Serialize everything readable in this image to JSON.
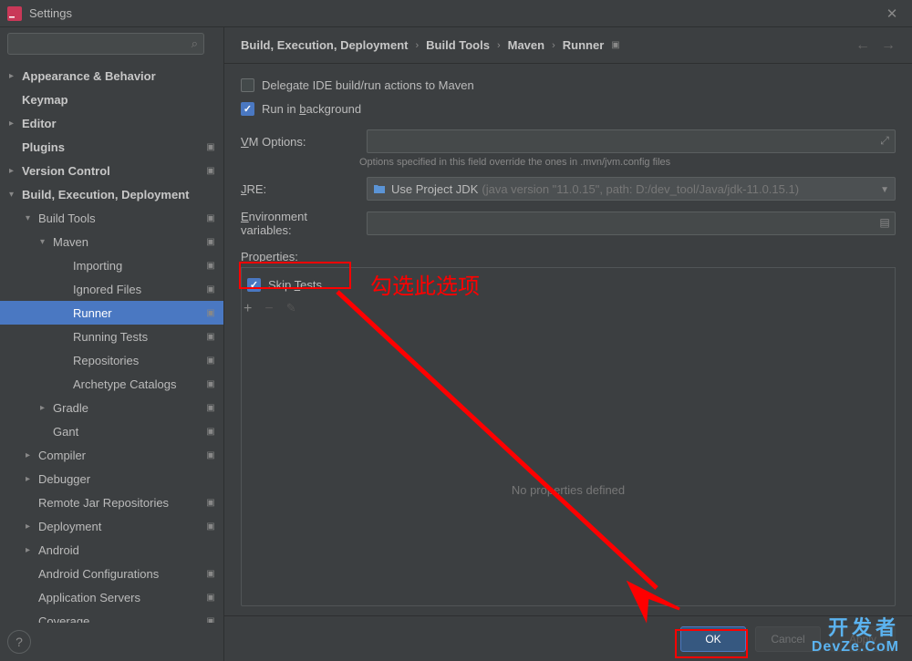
{
  "window": {
    "title": "Settings"
  },
  "search": {
    "placeholder": ""
  },
  "sidebar": {
    "items": [
      {
        "label": "Appearance & Behavior",
        "bold": true,
        "expandable": true,
        "expanded": false,
        "indent": 0,
        "mod": false
      },
      {
        "label": "Keymap",
        "bold": true,
        "expandable": false,
        "indent": 0,
        "mod": false
      },
      {
        "label": "Editor",
        "bold": true,
        "expandable": true,
        "expanded": false,
        "indent": 0,
        "mod": false
      },
      {
        "label": "Plugins",
        "bold": true,
        "expandable": false,
        "indent": 0,
        "mod": true
      },
      {
        "label": "Version Control",
        "bold": true,
        "expandable": true,
        "expanded": false,
        "indent": 0,
        "mod": true
      },
      {
        "label": "Build, Execution, Deployment",
        "bold": true,
        "expandable": true,
        "expanded": true,
        "indent": 0,
        "mod": false
      },
      {
        "label": "Build Tools",
        "bold": false,
        "expandable": true,
        "expanded": true,
        "indent": 1,
        "mod": true
      },
      {
        "label": "Maven",
        "bold": false,
        "expandable": true,
        "expanded": true,
        "indent": 2,
        "mod": true
      },
      {
        "label": "Importing",
        "bold": false,
        "expandable": false,
        "indent": 3,
        "mod": true
      },
      {
        "label": "Ignored Files",
        "bold": false,
        "expandable": false,
        "indent": 3,
        "mod": true
      },
      {
        "label": "Runner",
        "bold": false,
        "expandable": false,
        "indent": 3,
        "mod": true,
        "selected": true
      },
      {
        "label": "Running Tests",
        "bold": false,
        "expandable": false,
        "indent": 3,
        "mod": true
      },
      {
        "label": "Repositories",
        "bold": false,
        "expandable": false,
        "indent": 3,
        "mod": true
      },
      {
        "label": "Archetype Catalogs",
        "bold": false,
        "expandable": false,
        "indent": 3,
        "mod": true
      },
      {
        "label": "Gradle",
        "bold": false,
        "expandable": true,
        "expanded": false,
        "indent": 2,
        "mod": true
      },
      {
        "label": "Gant",
        "bold": false,
        "expandable": false,
        "indent": 2,
        "mod": true
      },
      {
        "label": "Compiler",
        "bold": false,
        "expandable": true,
        "expanded": false,
        "indent": 1,
        "mod": true
      },
      {
        "label": "Debugger",
        "bold": false,
        "expandable": true,
        "expanded": false,
        "indent": 1,
        "mod": false
      },
      {
        "label": "Remote Jar Repositories",
        "bold": false,
        "expandable": false,
        "indent": 1,
        "mod": true
      },
      {
        "label": "Deployment",
        "bold": false,
        "expandable": true,
        "expanded": false,
        "indent": 1,
        "mod": true
      },
      {
        "label": "Android",
        "bold": false,
        "expandable": true,
        "expanded": false,
        "indent": 1,
        "mod": false
      },
      {
        "label": "Android Configurations",
        "bold": false,
        "expandable": false,
        "indent": 1,
        "mod": true
      },
      {
        "label": "Application Servers",
        "bold": false,
        "expandable": false,
        "indent": 1,
        "mod": true
      },
      {
        "label": "Coverage",
        "bold": false,
        "expandable": false,
        "indent": 1,
        "mod": true
      }
    ]
  },
  "breadcrumb": {
    "parts": [
      "Build, Execution, Deployment",
      "Build Tools",
      "Maven",
      "Runner"
    ]
  },
  "form": {
    "delegate": {
      "label_pre": "",
      "label": "Delegate IDE build/run actions to Maven",
      "checked": false
    },
    "background": {
      "label_html": "Run in background",
      "underline": "b",
      "checked": true
    },
    "vm": {
      "label": "VM Options:",
      "underline": "V",
      "value": "",
      "hint": "Options specified in this field override the ones in .mvn/jvm.config files"
    },
    "jre": {
      "label": "JRE:",
      "underline": "J",
      "main": "Use Project JDK",
      "hint": "(java version \"11.0.15\", path: D:/dev_tool/Java/jdk-11.0.15.1)"
    },
    "env": {
      "label": "Environment variables:",
      "underline": "E",
      "value": ""
    },
    "properties": {
      "label": "Properties:"
    },
    "skip": {
      "label": "Skip Tests",
      "underline": "T",
      "checked": true
    },
    "empty": "No properties defined"
  },
  "buttons": {
    "ok": "OK",
    "cancel": "Cancel",
    "apply": "Apply"
  },
  "annotation": {
    "text": "勾选此选项"
  },
  "watermark": {
    "line1": "开发者",
    "line2": "DevZe.CoM"
  }
}
